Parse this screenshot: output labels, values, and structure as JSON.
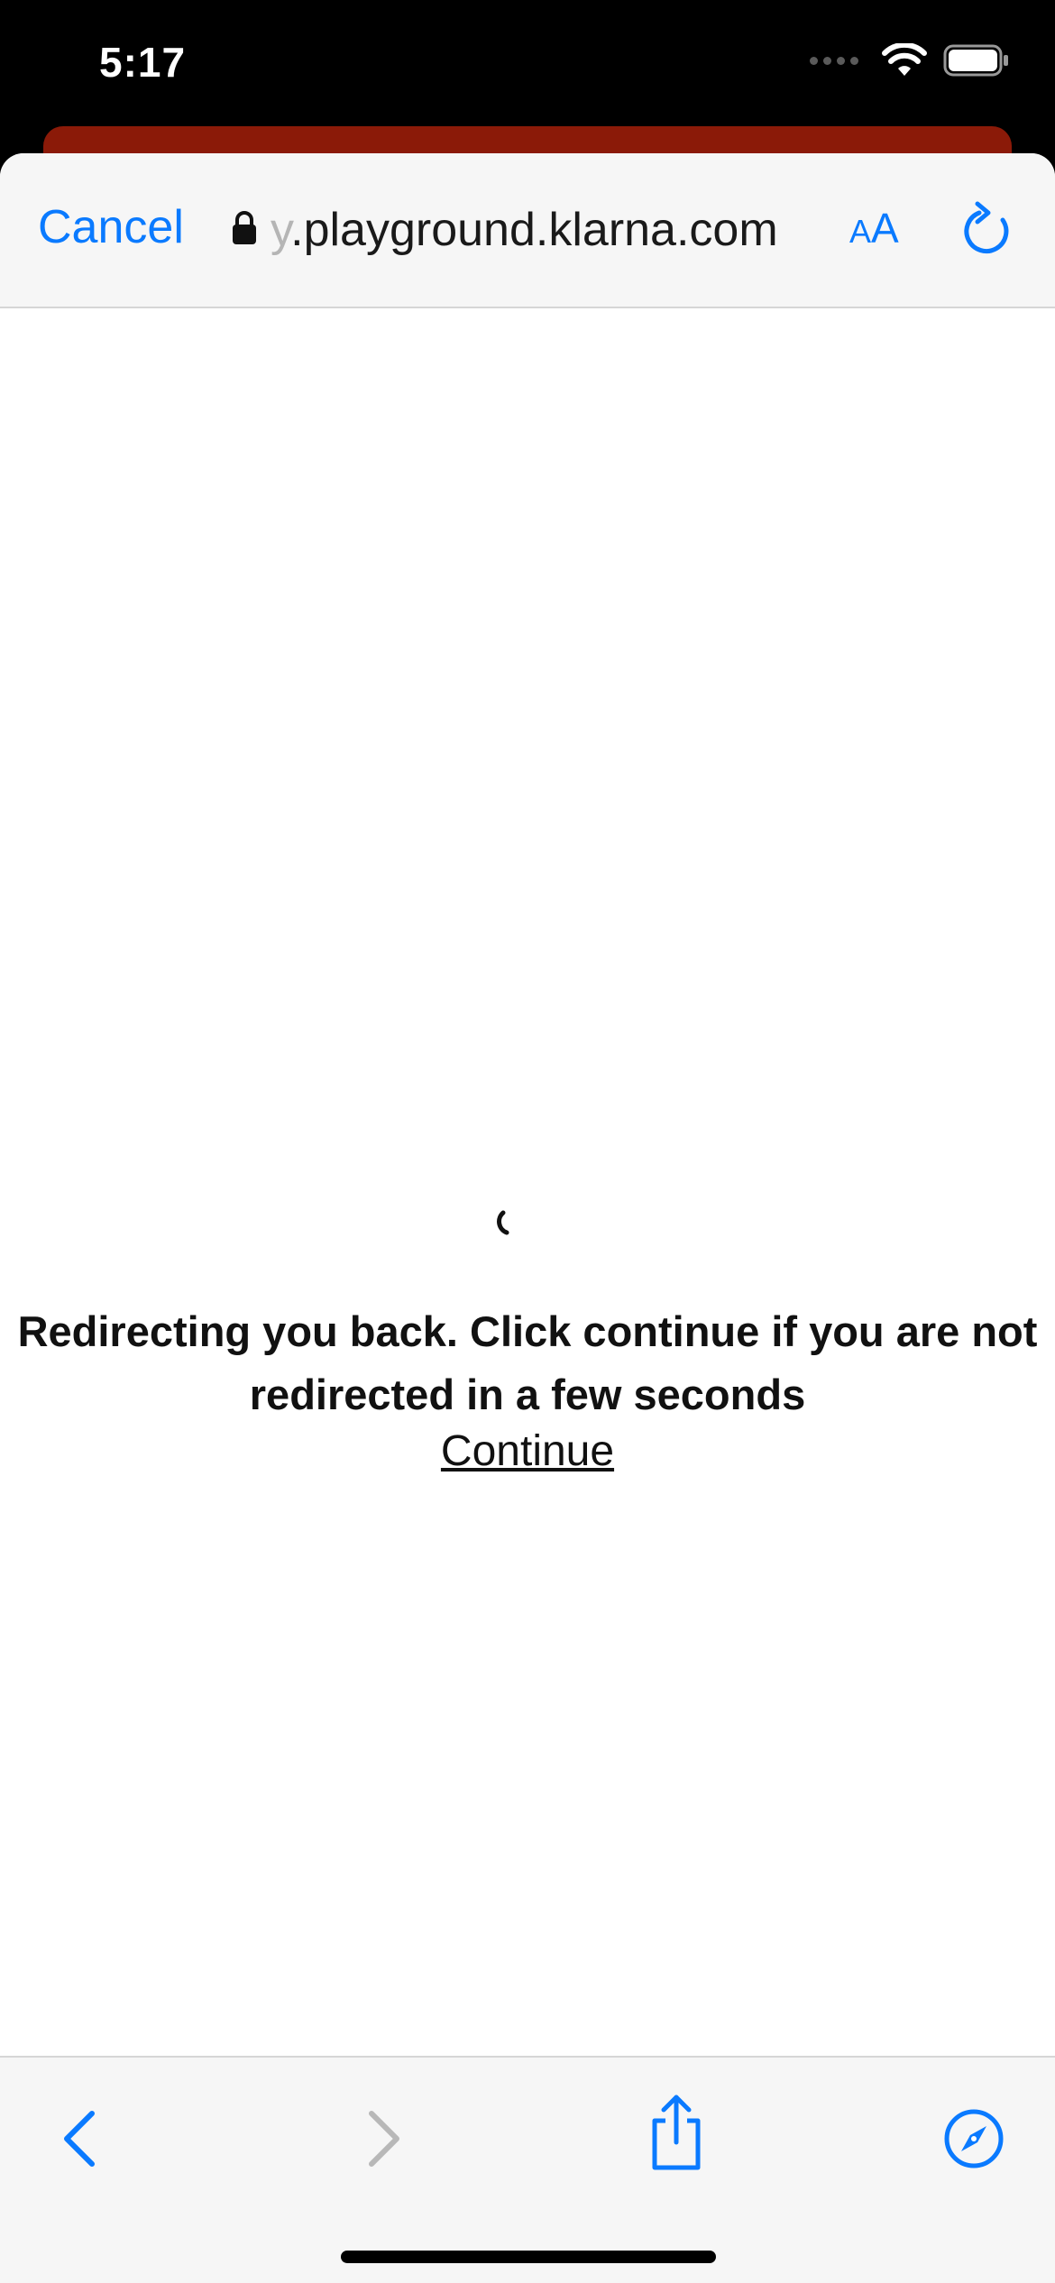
{
  "status_bar": {
    "time": "5:17"
  },
  "browser": {
    "cancel_label": "Cancel",
    "url_faded_prefix": "y",
    "url_main": ".playground.klarna.com",
    "text_size_label_small": "A",
    "text_size_label_large": "A"
  },
  "page": {
    "redirect_message": "Redirecting you back. Click continue if you are not redirected in a few seconds",
    "continue_label": "Continue"
  },
  "icons": {
    "lock": "lock-icon",
    "reload": "reload-icon",
    "back": "chevron-left-icon",
    "forward": "chevron-right-icon",
    "share": "share-icon",
    "safari": "compass-icon"
  },
  "colors": {
    "accent": "#0a7aff",
    "disabled": "#b8b8b8",
    "behind_sheet": "#8b1a08"
  }
}
